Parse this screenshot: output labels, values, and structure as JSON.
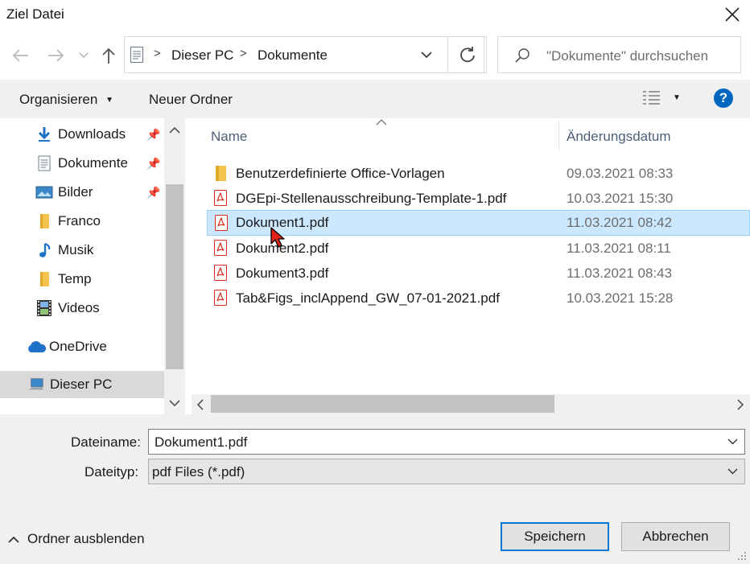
{
  "window": {
    "title": "Ziel Datei"
  },
  "nav": {
    "breadcrumb": [
      "Dieser PC",
      "Dokumente"
    ],
    "search_placeholder": "\"Dokumente\" durchsuchen"
  },
  "toolbar": {
    "organize": "Organisieren",
    "new_folder": "Neuer Ordner",
    "help": "?"
  },
  "sidebar": {
    "items": [
      {
        "label": "Downloads",
        "icon": "download-arrow-icon",
        "pinned": true
      },
      {
        "label": "Dokumente",
        "icon": "document-icon",
        "pinned": true
      },
      {
        "label": "Bilder",
        "icon": "pictures-icon",
        "pinned": true
      },
      {
        "label": "Franco",
        "icon": "folder-icon",
        "pinned": false
      },
      {
        "label": "Musik",
        "icon": "music-note-icon",
        "pinned": false
      },
      {
        "label": "Temp",
        "icon": "folder-icon",
        "pinned": false
      },
      {
        "label": "Videos",
        "icon": "film-icon",
        "pinned": false
      },
      {
        "label": "OneDrive",
        "icon": "cloud-icon",
        "pinned": false
      },
      {
        "label": "Dieser PC",
        "icon": "computer-icon",
        "pinned": false
      }
    ]
  },
  "filelist": {
    "columns": {
      "name": "Name",
      "date": "Änderungsdatum"
    },
    "rows": [
      {
        "name": "Benutzerdefinierte Office-Vorlagen",
        "date": "09.03.2021 08:33",
        "type": "folder"
      },
      {
        "name": "DGEpi-Stellenausschreibung-Template-1.pdf",
        "date": "10.03.2021 15:30",
        "type": "pdf"
      },
      {
        "name": "Dokument1.pdf",
        "date": "11.03.2021 08:42",
        "type": "pdf"
      },
      {
        "name": "Dokument2.pdf",
        "date": "11.03.2021 08:11",
        "type": "pdf"
      },
      {
        "name": "Dokument3.pdf",
        "date": "11.03.2021 08:43",
        "type": "pdf"
      },
      {
        "name": "Tab&Figs_inclAppend_GW_07-01-2021.pdf",
        "date": "10.03.2021 15:28",
        "type": "pdf"
      }
    ]
  },
  "form": {
    "filename_label": "Dateiname:",
    "filename_value": "Dokument1.pdf",
    "filetype_label": "Dateityp:",
    "filetype_value": "pdf Files (*.pdf)"
  },
  "footer": {
    "hide_folders": "Ordner ausblenden",
    "save": "Speichern",
    "cancel": "Abbrechen"
  },
  "colors": {
    "selection": "#cce8ff",
    "accent": "#0078d7",
    "pdf": "#d9291c",
    "folder": "#f5c24a"
  }
}
